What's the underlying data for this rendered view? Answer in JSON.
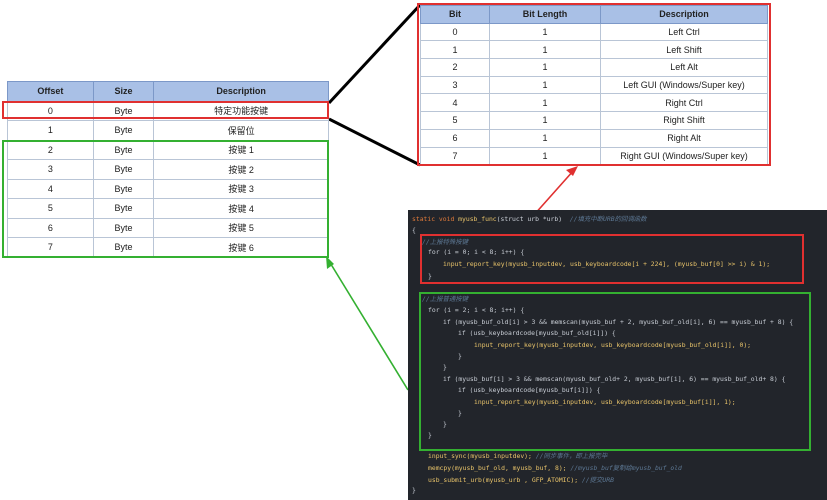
{
  "left_table": {
    "headers": [
      "Offset",
      "Size",
      "Description"
    ],
    "rows": [
      [
        "0",
        "Byte",
        "特定功能按键"
      ],
      [
        "1",
        "Byte",
        "保留位"
      ],
      [
        "2",
        "Byte",
        "按键 1"
      ],
      [
        "3",
        "Byte",
        "按键 2"
      ],
      [
        "4",
        "Byte",
        "按键 3"
      ],
      [
        "5",
        "Byte",
        "按键 4"
      ],
      [
        "6",
        "Byte",
        "按键 5"
      ],
      [
        "7",
        "Byte",
        "按键 6"
      ]
    ]
  },
  "right_table": {
    "headers": [
      "Bit",
      "Bit Length",
      "Description"
    ],
    "rows": [
      [
        "0",
        "1",
        "Left Ctrl"
      ],
      [
        "1",
        "1",
        "Left Shift"
      ],
      [
        "2",
        "1",
        "Left Alt"
      ],
      [
        "3",
        "1",
        "Left GUI (Windows/Super key)"
      ],
      [
        "4",
        "1",
        "Right Ctrl"
      ],
      [
        "5",
        "1",
        "Right Shift"
      ],
      [
        "6",
        "1",
        "Right Alt"
      ],
      [
        "7",
        "1",
        "Right GUI (Windows/Super key)"
      ]
    ]
  },
  "code": {
    "line1_kw": "static void ",
    "line1_fn": "myusb_func",
    "line1_args": "(struct urb *urb)  ",
    "line1_comment": "//填充中断URB的回调函数",
    "open_brace": "{",
    "comment_special": "//上报特殊按键",
    "for1": "for (i = 0; i < 8; i++) {",
    "report1": "input_report_key(myusb_inputdev, usb_keyboardcode[i + 224], (myusb_buf[0] >> i) & 1);",
    "close1": "}",
    "comment_normal": "//上报普通按键",
    "for2": "for (i = 2; i < 8; i++) {",
    "if1": "if (myusb_buf_old[i] > 3 && memscan(myusb_buf + 2, myusb_buf_old[i], 6) == myusb_buf + 8) {",
    "if1b": "if (usb_keyboardcode[myusb_buf_old[i]]) {",
    "report2": "input_report_key(myusb_inputdev, usb_keyboardcode[myusb_buf_old[i]], 0);",
    "close2": "}",
    "close3": "}",
    "if2": "if (myusb_buf[i] > 3 && memscan(myusb_buf_old+ 2, myusb_buf[i], 6) == myusb_buf_old+ 8) {",
    "if2b": "if (usb_keyboardcode[myusb_buf[i]]) {",
    "report3": "input_report_key(myusb_inputdev, usb_keyboardcode[myusb_buf[i]], 1);",
    "close4": "}",
    "close5": "}",
    "close6": "}",
    "sync": "input_sync(myusb_inputdev);",
    "sync_comment": " //同步事件，即上报完毕",
    "memcpy": "memcpy(myusb_buf_old, myusb_buf, 8);",
    "memcpy_comment": " //myusb_buf复制给myusb_buf_old",
    "submit": "usb_submit_urb(myusb_urb , GFP_ATOMIC);",
    "submit_comment": " //提交URB",
    "close_final": "}"
  },
  "colors": {
    "header_bg": "#a9c0e6",
    "highlight_red": "#e03030",
    "highlight_green": "#34b031",
    "code_bg": "#22252b",
    "connector": "#000000"
  }
}
